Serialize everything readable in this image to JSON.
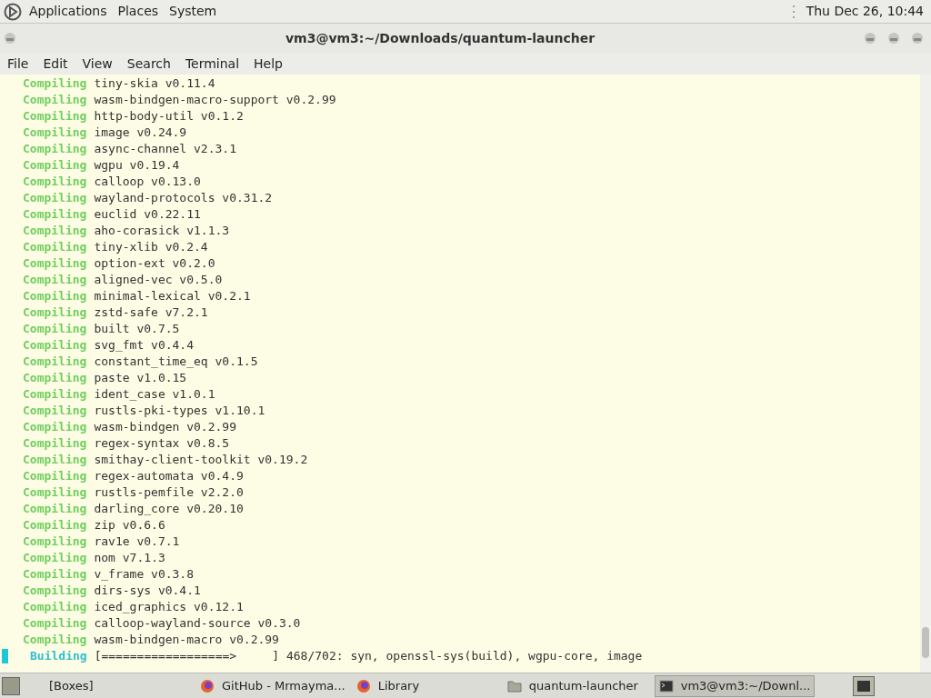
{
  "top_panel": {
    "menus": [
      "Applications",
      "Places",
      "System"
    ],
    "clock": "Thu Dec 26, 10:44"
  },
  "window": {
    "title": "vm3@vm3:~/Downloads/quantum-launcher"
  },
  "menu_bar": [
    "File",
    "Edit",
    "View",
    "Search",
    "Terminal",
    "Help"
  ],
  "terminal": {
    "lines": [
      {
        "kind": "compiling",
        "label": "Compiling",
        "text": "tiny-skia v0.11.4"
      },
      {
        "kind": "compiling",
        "label": "Compiling",
        "text": "wasm-bindgen-macro-support v0.2.99"
      },
      {
        "kind": "compiling",
        "label": "Compiling",
        "text": "http-body-util v0.1.2"
      },
      {
        "kind": "compiling",
        "label": "Compiling",
        "text": "image v0.24.9"
      },
      {
        "kind": "compiling",
        "label": "Compiling",
        "text": "async-channel v2.3.1"
      },
      {
        "kind": "compiling",
        "label": "Compiling",
        "text": "wgpu v0.19.4"
      },
      {
        "kind": "compiling",
        "label": "Compiling",
        "text": "calloop v0.13.0"
      },
      {
        "kind": "compiling",
        "label": "Compiling",
        "text": "wayland-protocols v0.31.2"
      },
      {
        "kind": "compiling",
        "label": "Compiling",
        "text": "euclid v0.22.11"
      },
      {
        "kind": "compiling",
        "label": "Compiling",
        "text": "aho-corasick v1.1.3"
      },
      {
        "kind": "compiling",
        "label": "Compiling",
        "text": "tiny-xlib v0.2.4"
      },
      {
        "kind": "compiling",
        "label": "Compiling",
        "text": "option-ext v0.2.0"
      },
      {
        "kind": "compiling",
        "label": "Compiling",
        "text": "aligned-vec v0.5.0"
      },
      {
        "kind": "compiling",
        "label": "Compiling",
        "text": "minimal-lexical v0.2.1"
      },
      {
        "kind": "compiling",
        "label": "Compiling",
        "text": "zstd-safe v7.2.1"
      },
      {
        "kind": "compiling",
        "label": "Compiling",
        "text": "built v0.7.5"
      },
      {
        "kind": "compiling",
        "label": "Compiling",
        "text": "svg_fmt v0.4.4"
      },
      {
        "kind": "compiling",
        "label": "Compiling",
        "text": "constant_time_eq v0.1.5"
      },
      {
        "kind": "compiling",
        "label": "Compiling",
        "text": "paste v1.0.15"
      },
      {
        "kind": "compiling",
        "label": "Compiling",
        "text": "ident_case v1.0.1"
      },
      {
        "kind": "compiling",
        "label": "Compiling",
        "text": "rustls-pki-types v1.10.1"
      },
      {
        "kind": "compiling",
        "label": "Compiling",
        "text": "wasm-bindgen v0.2.99"
      },
      {
        "kind": "compiling",
        "label": "Compiling",
        "text": "regex-syntax v0.8.5"
      },
      {
        "kind": "compiling",
        "label": "Compiling",
        "text": "smithay-client-toolkit v0.19.2"
      },
      {
        "kind": "compiling",
        "label": "Compiling",
        "text": "regex-automata v0.4.9"
      },
      {
        "kind": "compiling",
        "label": "Compiling",
        "text": "rustls-pemfile v2.2.0"
      },
      {
        "kind": "compiling",
        "label": "Compiling",
        "text": "darling_core v0.20.10"
      },
      {
        "kind": "compiling",
        "label": "Compiling",
        "text": "zip v0.6.6"
      },
      {
        "kind": "compiling",
        "label": "Compiling",
        "text": "rav1e v0.7.1"
      },
      {
        "kind": "compiling",
        "label": "Compiling",
        "text": "nom v7.1.3"
      },
      {
        "kind": "compiling",
        "label": "Compiling",
        "text": "v_frame v0.3.8"
      },
      {
        "kind": "compiling",
        "label": "Compiling",
        "text": "dirs-sys v0.4.1"
      },
      {
        "kind": "compiling",
        "label": "Compiling",
        "text": "iced_graphics v0.12.1"
      },
      {
        "kind": "compiling",
        "label": "Compiling",
        "text": "calloop-wayland-source v0.3.0"
      },
      {
        "kind": "compiling",
        "label": "Compiling",
        "text": "wasm-bindgen-macro v0.2.99"
      },
      {
        "kind": "building",
        "label": "Building",
        "text": "[==================>     ] 468/702: syn, openssl-sys(build), wgpu-core, image"
      }
    ]
  },
  "taskbar": [
    {
      "kind": "boxes",
      "label": "[Boxes]",
      "selected": false
    },
    {
      "kind": "browser",
      "label": "GitHub - Mrmayma...",
      "selected": false
    },
    {
      "kind": "browser",
      "label": "Library",
      "selected": false
    },
    {
      "kind": "folder",
      "label": "quantum-launcher",
      "selected": false
    },
    {
      "kind": "terminal",
      "label": "vm3@vm3:~/Downl...",
      "selected": true
    }
  ]
}
